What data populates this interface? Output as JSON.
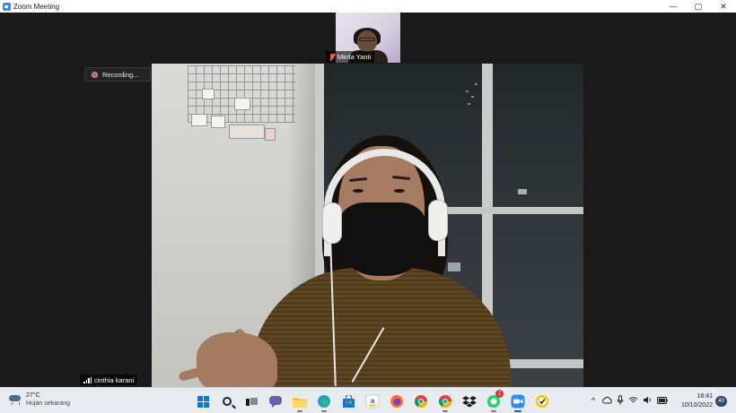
{
  "window": {
    "title": "Zoom Meeting",
    "controls": {
      "minimize": "—",
      "maximize": "▢",
      "close": "✕"
    }
  },
  "meeting": {
    "thumbnail_participant": "Mirda Yanti",
    "recording_label": "Recording...",
    "active_speaker": "cinthia karani"
  },
  "taskbar": {
    "weather": {
      "temperature": "27°C",
      "description": "Hujan sekarang"
    },
    "apps": [
      {
        "name": "start",
        "icon": "windows-logo-icon"
      },
      {
        "name": "search",
        "icon": "search-icon"
      },
      {
        "name": "task-view",
        "icon": "task-view-icon"
      },
      {
        "name": "teams-chat",
        "icon": "chat-icon",
        "color": "#6264a7"
      },
      {
        "name": "file-explorer",
        "icon": "folder-icon",
        "color": "#f6c343"
      },
      {
        "name": "edge",
        "icon": "edge-icon",
        "color": "#1ea1c5"
      },
      {
        "name": "store",
        "icon": "store-icon",
        "color": "#0a78d4"
      },
      {
        "name": "amazon",
        "icon": "amazon-icon",
        "glyph": "a"
      },
      {
        "name": "firefox",
        "icon": "firefox-icon",
        "color": "#ff6f30"
      },
      {
        "name": "chrome-1",
        "icon": "chrome-icon"
      },
      {
        "name": "chrome-2",
        "icon": "chrome-icon"
      },
      {
        "name": "dropbox",
        "icon": "dropbox-icon",
        "color": "#0061fe"
      },
      {
        "name": "whatsapp",
        "icon": "whatsapp-icon",
        "color": "#25d366",
        "badge": "2"
      },
      {
        "name": "zoom",
        "icon": "zoom-icon",
        "color": "#2d8cff"
      },
      {
        "name": "norton",
        "icon": "norton-icon",
        "color": "#f5c400"
      }
    ],
    "tray": {
      "chevron": "^",
      "icons": [
        "cloud-icon",
        "microphone-icon",
        "wifi-icon",
        "speaker-icon",
        "battery-icon"
      ]
    },
    "clock": {
      "time": "18:41",
      "date": "10/10/2022"
    },
    "notifications": "40"
  }
}
